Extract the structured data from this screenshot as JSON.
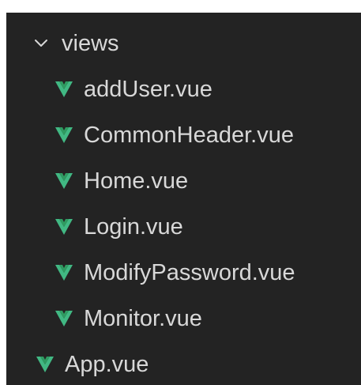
{
  "top_link": {
    "text": ""
  },
  "explorer": {
    "folder": {
      "label": "views",
      "expanded": true,
      "chevron_icon": "chevron-down-icon"
    },
    "files": [
      {
        "label": "addUser.vue",
        "icon": "vue-icon"
      },
      {
        "label": "CommonHeader.vue",
        "icon": "vue-icon"
      },
      {
        "label": "Home.vue",
        "icon": "vue-icon"
      },
      {
        "label": "Login.vue",
        "icon": "vue-icon"
      },
      {
        "label": "ModifyPassword.vue",
        "icon": "vue-icon"
      },
      {
        "label": "Monitor.vue",
        "icon": "vue-icon"
      }
    ],
    "root_file": {
      "label": "App.vue",
      "icon": "vue-icon"
    }
  },
  "colors": {
    "background": "#232323",
    "text": "#d8d8d8",
    "vue_green": "#41b883",
    "vue_green_dark": "#2f9b61",
    "link_blue": "#0b57d0"
  }
}
